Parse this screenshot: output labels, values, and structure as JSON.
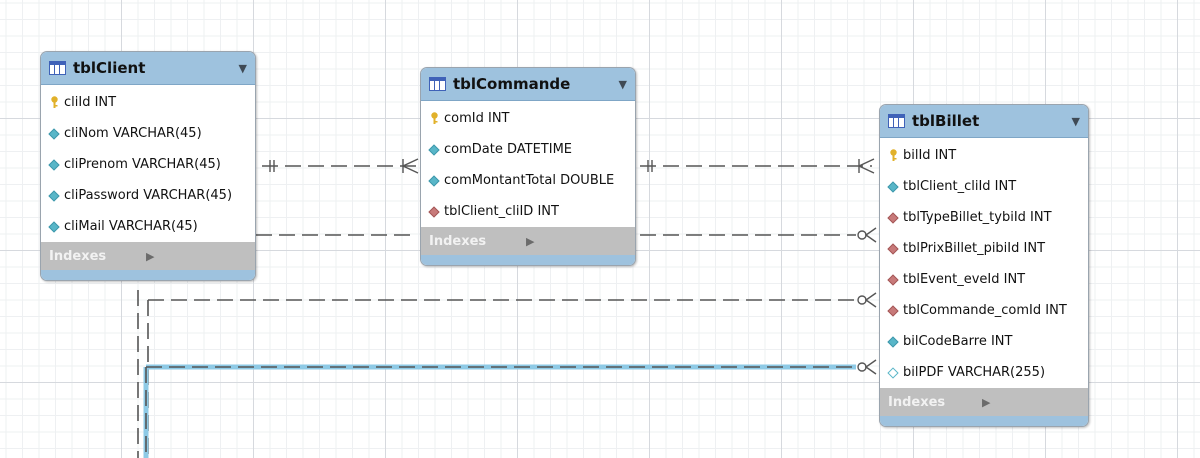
{
  "tables": [
    {
      "id": "client",
      "title": "tblClient",
      "indexes_label": "Indexes",
      "columns": [
        {
          "icon": "key",
          "text": "cliId INT"
        },
        {
          "icon": "diamond-filled",
          "text": "cliNom VARCHAR(45)"
        },
        {
          "icon": "diamond-filled",
          "text": "cliPrenom VARCHAR(45)"
        },
        {
          "icon": "diamond-filled",
          "text": "cliPassword VARCHAR(45)"
        },
        {
          "icon": "diamond-filled",
          "text": "cliMail VARCHAR(45)"
        }
      ]
    },
    {
      "id": "commande",
      "title": "tblCommande",
      "indexes_label": "Indexes",
      "columns": [
        {
          "icon": "key",
          "text": "comId INT"
        },
        {
          "icon": "diamond-filled",
          "text": "comDate DATETIME"
        },
        {
          "icon": "diamond-filled",
          "text": "comMontantTotal DOUBLE"
        },
        {
          "icon": "diamond-fk",
          "text": "tblClient_cliID INT"
        }
      ]
    },
    {
      "id": "billet",
      "title": "tblBillet",
      "indexes_label": "Indexes",
      "columns": [
        {
          "icon": "key",
          "text": "bilId INT"
        },
        {
          "icon": "diamond-filled",
          "text": "tblClient_cliId INT"
        },
        {
          "icon": "diamond-fk",
          "text": "tblTypeBillet_tybiId INT"
        },
        {
          "icon": "diamond-fk",
          "text": "tblPrixBillet_pibiId INT"
        },
        {
          "icon": "diamond-fk",
          "text": "tblEvent_eveId INT"
        },
        {
          "icon": "diamond-fk",
          "text": "tblCommande_comId INT"
        },
        {
          "icon": "diamond-filled",
          "text": "bilCodeBarre INT"
        },
        {
          "icon": "diamond-hollow",
          "text": "bilPDF VARCHAR(255)"
        }
      ]
    }
  ],
  "colors": {
    "header": "#9ec2de",
    "indexes": "#bfbfbf",
    "key": "#e1b12a",
    "attribute": "#58b6c8",
    "foreign_key": "#c87a7a",
    "connector": "#555555",
    "connector_highlight": "#8ecae6"
  }
}
